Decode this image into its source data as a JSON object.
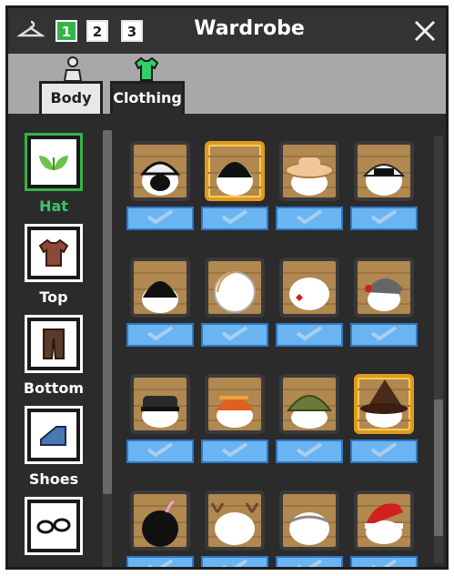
{
  "window": {
    "title": "Wardrobe"
  },
  "header": {
    "outfit_tabs": [
      {
        "label": "1",
        "active": true
      },
      {
        "label": "2",
        "active": false
      },
      {
        "label": "3",
        "active": false
      }
    ],
    "icons": {
      "left": "hanger-icon",
      "right": "close-icon"
    }
  },
  "tabs": [
    {
      "label": "Body",
      "icon": "mannequin-icon",
      "active": false
    },
    {
      "label": "Clothing",
      "icon": "shirt-icon",
      "active": true
    }
  ],
  "categories": [
    {
      "label": "Hat",
      "icon": "hat-icon",
      "selected": true
    },
    {
      "label": "Top",
      "icon": "shirt-icon",
      "selected": false
    },
    {
      "label": "Bottom",
      "icon": "pants-icon",
      "selected": false
    },
    {
      "label": "Shoes",
      "icon": "shoe-icon",
      "selected": false
    },
    {
      "label": "",
      "icon": "glasses-icon",
      "selected": false
    }
  ],
  "colors": {
    "accent_green": "#36b34a",
    "select_blue": "#6ab4f2",
    "equipped_gold": "#e09a20"
  },
  "items": [
    {
      "name": "white-bandana-hat",
      "equipped": false
    },
    {
      "name": "black-beanie-hat",
      "equipped": true
    },
    {
      "name": "straw-hat",
      "equipped": false
    },
    {
      "name": "aviator-cap-hat",
      "equipped": false
    },
    {
      "name": "black-knit-hat",
      "equipped": false
    },
    {
      "name": "white-helmet-hat",
      "equipped": false
    },
    {
      "name": "bow-hat",
      "equipped": false
    },
    {
      "name": "grey-beret-hat",
      "equipped": false
    },
    {
      "name": "police-cap-hat",
      "equipped": false
    },
    {
      "name": "orange-beanie-hat",
      "equipped": false
    },
    {
      "name": "army-helmet-hat",
      "equipped": false
    },
    {
      "name": "witch-hat",
      "equipped": true
    },
    {
      "name": "bomb-hat",
      "equipped": false
    },
    {
      "name": "antlers-hat",
      "equipped": false
    },
    {
      "name": "bandage-hat",
      "equipped": false
    },
    {
      "name": "santa-hat",
      "equipped": false
    }
  ]
}
